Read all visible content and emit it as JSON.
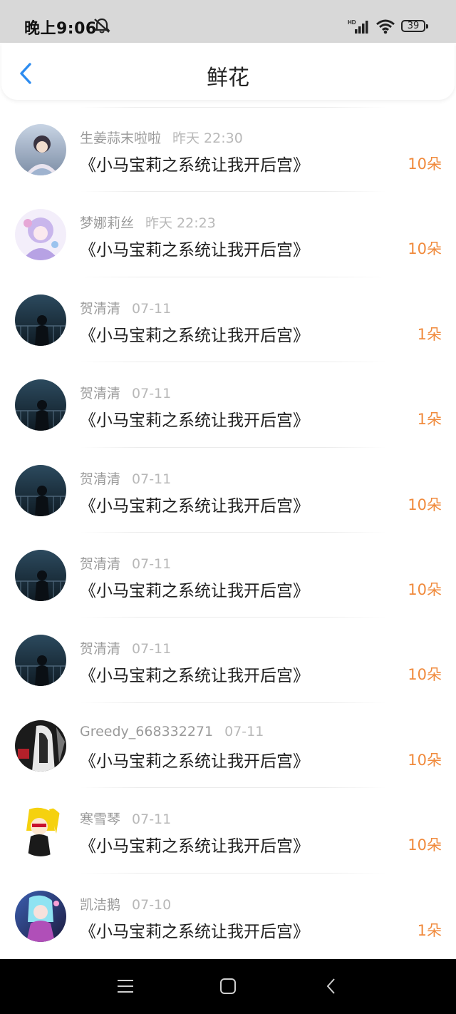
{
  "status_bar": {
    "time": "晚上9:06",
    "battery": "39",
    "icons": [
      "mute-icon",
      "signal-icon",
      "wifi-icon",
      "battery-icon"
    ]
  },
  "header": {
    "title": "鲜花",
    "back_icon": "chevron-left-icon"
  },
  "colors": {
    "accent": "#2d8cf0",
    "count": "#f08a3c",
    "meta": "#9a9a9a"
  },
  "records": [
    {
      "user": "生姜蒜末啦啦",
      "date": "昨天 22:30",
      "book": "《小马宝莉之系统让我开后宫》",
      "count": "10朵"
    },
    {
      "user": "梦娜莉丝",
      "date": "昨天 22:23",
      "book": "《小马宝莉之系统让我开后宫》",
      "count": "10朵"
    },
    {
      "user": "贺清清",
      "date": "07-11",
      "book": "《小马宝莉之系统让我开后宫》",
      "count": "1朵"
    },
    {
      "user": "贺清清",
      "date": "07-11",
      "book": "《小马宝莉之系统让我开后宫》",
      "count": "1朵"
    },
    {
      "user": "贺清清",
      "date": "07-11",
      "book": "《小马宝莉之系统让我开后宫》",
      "count": "10朵"
    },
    {
      "user": "贺清清",
      "date": "07-11",
      "book": "《小马宝莉之系统让我开后宫》",
      "count": "10朵"
    },
    {
      "user": "贺清清",
      "date": "07-11",
      "book": "《小马宝莉之系统让我开后宫》",
      "count": "10朵"
    },
    {
      "user": "Greedy_668332271",
      "date": "07-11",
      "book": "《小马宝莉之系统让我开后宫》",
      "count": "10朵"
    },
    {
      "user": "寒雪琴",
      "date": "07-11",
      "book": "《小马宝莉之系统让我开后宫》",
      "count": "10朵"
    },
    {
      "user": "凯洁鹅",
      "date": "07-10",
      "book": "《小马宝莉之系统让我开后宫》",
      "count": "1朵"
    }
  ],
  "system_nav": {
    "icons": [
      "menu-icon",
      "home-icon",
      "back-icon"
    ]
  }
}
